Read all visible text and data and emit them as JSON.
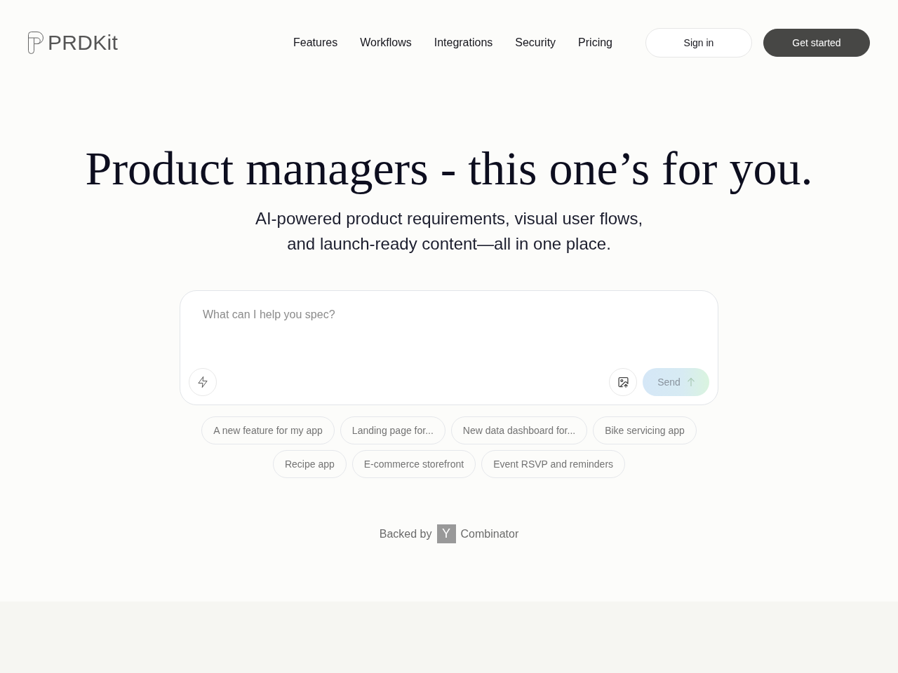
{
  "header": {
    "brand": "PRDKit",
    "nav": [
      "Features",
      "Workflows",
      "Integrations",
      "Security",
      "Pricing"
    ],
    "buttons": [
      {
        "label": "Sign in",
        "kind": "secondary"
      },
      {
        "label": "Get started",
        "kind": "primary"
      }
    ]
  },
  "hero": {
    "title": "Product managers - this one’s for you.",
    "subtitle": "AI-powered product requirements, visual user flows, and launch-ready content—all in one place."
  },
  "prompt": {
    "placeholder": "What can I help you spec?",
    "send": {
      "label": "Send",
      "disabled": true
    }
  },
  "suggestions": [
    "A new feature for my app",
    "Landing page for...",
    "New data dashboard for...",
    "Bike servicing app",
    "Recipe app",
    "E-commerce storefront",
    "Event RSVP and reminders"
  ],
  "backed_by": {
    "prefix": "Backed by",
    "logo_letter": "Y",
    "suffix": "Combinator"
  }
}
